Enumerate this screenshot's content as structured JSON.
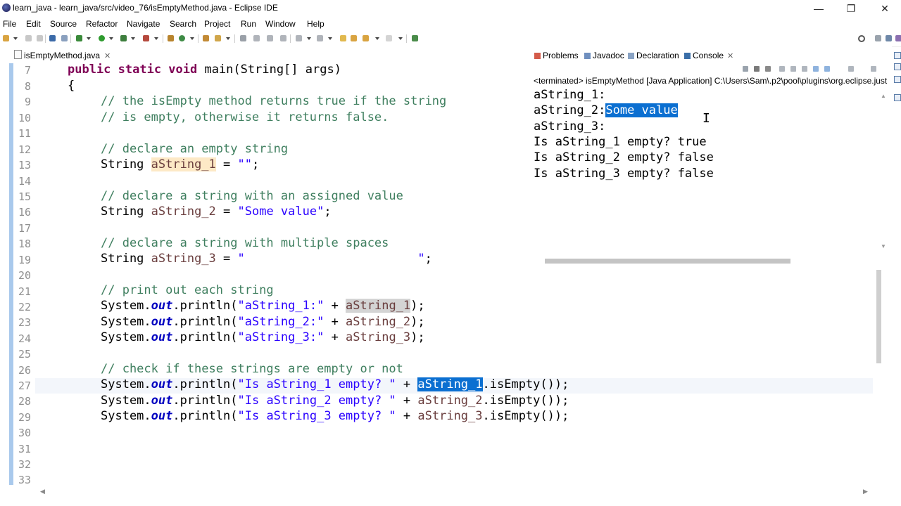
{
  "window": {
    "title": "learn_java - learn_java/src/video_76/isEmptyMethod.java - Eclipse IDE",
    "minimize": "—",
    "restore": "❐",
    "close": "✕"
  },
  "menu": [
    "File",
    "Edit",
    "Source",
    "Refactor",
    "Navigate",
    "Search",
    "Project",
    "Run",
    "Window",
    "Help"
  ],
  "editor": {
    "tab_label": "isEmptyMethod.java",
    "tab_close": "✕",
    "line_numbers": [
      "7",
      "8",
      "9",
      "10",
      "11",
      "12",
      "13",
      "14",
      "15",
      "16",
      "17",
      "18",
      "19",
      "20",
      "21",
      "22",
      "23",
      "24",
      "25",
      "26",
      "27",
      "28",
      "29",
      "30",
      "31",
      "32",
      "33"
    ],
    "code": {
      "l7": {
        "kw": "public static void",
        "rest": " main(String[] args)"
      },
      "l8": "{",
      "l9": "// the isEmpty method returns true if the string",
      "l10": "// is empty, otherwise it returns false.",
      "l12": "// declare an empty string",
      "l13": {
        "type": "String ",
        "var": "aString_1",
        "rest": " = ",
        "str": "\"\"",
        "end": ";"
      },
      "l15": "// declare a string with an assigned value",
      "l16": {
        "type": "String ",
        "var": "aString_2",
        "rest": " = ",
        "str": "\"Some value\"",
        "end": ";"
      },
      "l18": "// declare a string with multiple spaces",
      "l19": {
        "type": "String ",
        "var": "aString_3",
        "rest": " = ",
        "str": "\"                        \"",
        "end": ";"
      },
      "l21": "// print out each string",
      "print_prefix": "System.",
      "out": "out",
      "println": ".println(",
      "l22": {
        "str": "\"aString_1:\"",
        "plus": " + ",
        "var": "aString_1",
        "end": ");"
      },
      "l23": {
        "str": "\"aString_2:\"",
        "plus": " + ",
        "var": "aString_2",
        "end": ");"
      },
      "l24": {
        "str": "\"aString_3:\"",
        "plus": " + ",
        "var": "aString_3",
        "end": ");"
      },
      "l26": "// check if these strings are empty or not",
      "l27": {
        "str": "\"Is aString_1 empty? \"",
        "plus": " + ",
        "var": "aString_1",
        "end": ".isEmpty());"
      },
      "l28": {
        "str": "\"Is aString_2 empty? \"",
        "plus": " + ",
        "var": "aString_2",
        "end": ".isEmpty());"
      },
      "l29": {
        "str": "\"Is aString_3 empty? \"",
        "plus": " + ",
        "var": "aString_3",
        "end": ".isEmpty());"
      }
    }
  },
  "views": {
    "tabs": [
      "Problems",
      "Javadoc",
      "Declaration",
      "Console"
    ],
    "console_close": "✕",
    "status": "<terminated> isEmptyMethod [Java Application] C:\\Users\\Sam\\.p2\\pool\\plugins\\org.eclipse.just",
    "output": {
      "line1": "aString_1:",
      "line2_prefix": "aString_2:",
      "line2_selected": "Some value",
      "line3": "aString_3:",
      "line4": "Is aString_1 empty? true",
      "line5": "Is aString_2 empty? false",
      "line6": "Is aString_3 empty? false"
    }
  },
  "icons": {
    "text_cursor": "I",
    "scroll_left": "◀",
    "scroll_right": "▶",
    "scroll_up": "▲",
    "scroll_down": "▼"
  },
  "colors": {
    "keyword": "#7f0055",
    "comment": "#3f7f5f",
    "string": "#2a00ff",
    "field": "#0000c0",
    "selection": "#0b6fd1"
  }
}
